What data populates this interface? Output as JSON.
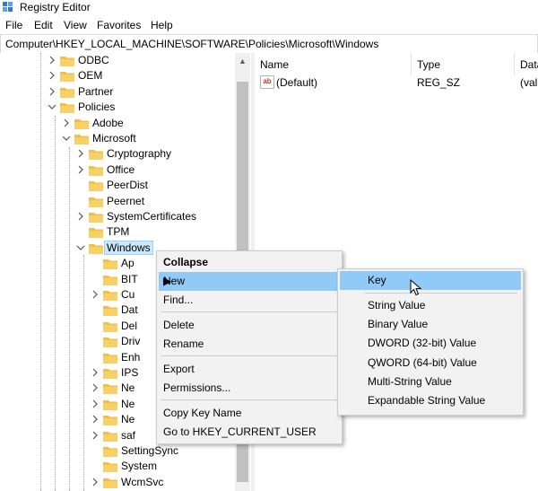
{
  "window": {
    "title": "Registry Editor"
  },
  "menu": [
    "File",
    "Edit",
    "View",
    "Favorites",
    "Help"
  ],
  "address": "Computer\\HKEY_LOCAL_MACHINE\\SOFTWARE\\Policies\\Microsoft\\Windows",
  "tree": [
    {
      "label": "ODBC",
      "expander": "collapsed"
    },
    {
      "label": "OEM",
      "expander": "collapsed"
    },
    {
      "label": "Partner",
      "expander": "collapsed"
    },
    {
      "label": "Policies",
      "expander": "expanded"
    },
    {
      "label": "Adobe",
      "expander": "collapsed"
    },
    {
      "label": "Microsoft",
      "expander": "expanded"
    },
    {
      "label": "Cryptography",
      "expander": "collapsed"
    },
    {
      "label": "Office",
      "expander": "collapsed"
    },
    {
      "label": "PeerDist",
      "expander": "none"
    },
    {
      "label": "Peernet",
      "expander": "none"
    },
    {
      "label": "SystemCertificates",
      "expander": "collapsed"
    },
    {
      "label": "TPM",
      "expander": "none"
    },
    {
      "label": "Windows",
      "expander": "expanded"
    },
    {
      "label": "Ap",
      "expander": "none"
    },
    {
      "label": "BIT",
      "expander": "none"
    },
    {
      "label": "Cu",
      "expander": "collapsed"
    },
    {
      "label": "Dat",
      "expander": "none"
    },
    {
      "label": "Del",
      "expander": "none"
    },
    {
      "label": "Driv",
      "expander": "none"
    },
    {
      "label": "Enh",
      "expander": "none"
    },
    {
      "label": "IPS",
      "expander": "collapsed"
    },
    {
      "label": "Ne",
      "expander": "collapsed"
    },
    {
      "label": "Ne",
      "expander": "collapsed"
    },
    {
      "label": "Ne",
      "expander": "collapsed"
    },
    {
      "label": "saf",
      "expander": "collapsed"
    },
    {
      "label": "SettingSync",
      "expander": "none"
    },
    {
      "label": "System",
      "expander": "none"
    },
    {
      "label": "WcmSvc",
      "expander": "collapsed"
    }
  ],
  "columns": {
    "name": "Name",
    "type": "Type",
    "data": "Data"
  },
  "values": [
    {
      "name": "(Default)",
      "type": "REG_SZ",
      "data": "(val"
    }
  ],
  "context_menu": [
    "Collapse",
    "New",
    "Find...",
    "Delete",
    "Rename",
    "Export",
    "Permissions...",
    "Copy Key Name",
    "Go to HKEY_CURRENT_USER"
  ],
  "submenu": [
    "Key",
    "String Value",
    "Binary Value",
    "DWORD (32-bit) Value",
    "QWORD (64-bit) Value",
    "Multi-String Value",
    "Expandable String Value"
  ],
  "colors": {
    "selection": "#cce8ff",
    "menu_highlight": "#91c9f7",
    "folder": "#f0c040"
  },
  "icons": {
    "app": "registry-cube-icon",
    "folder": "folder-icon",
    "value": "ab-string-value-icon",
    "submenu_arrow": "chevron-right-icon",
    "cursor": "mouse-pointer-icon"
  }
}
